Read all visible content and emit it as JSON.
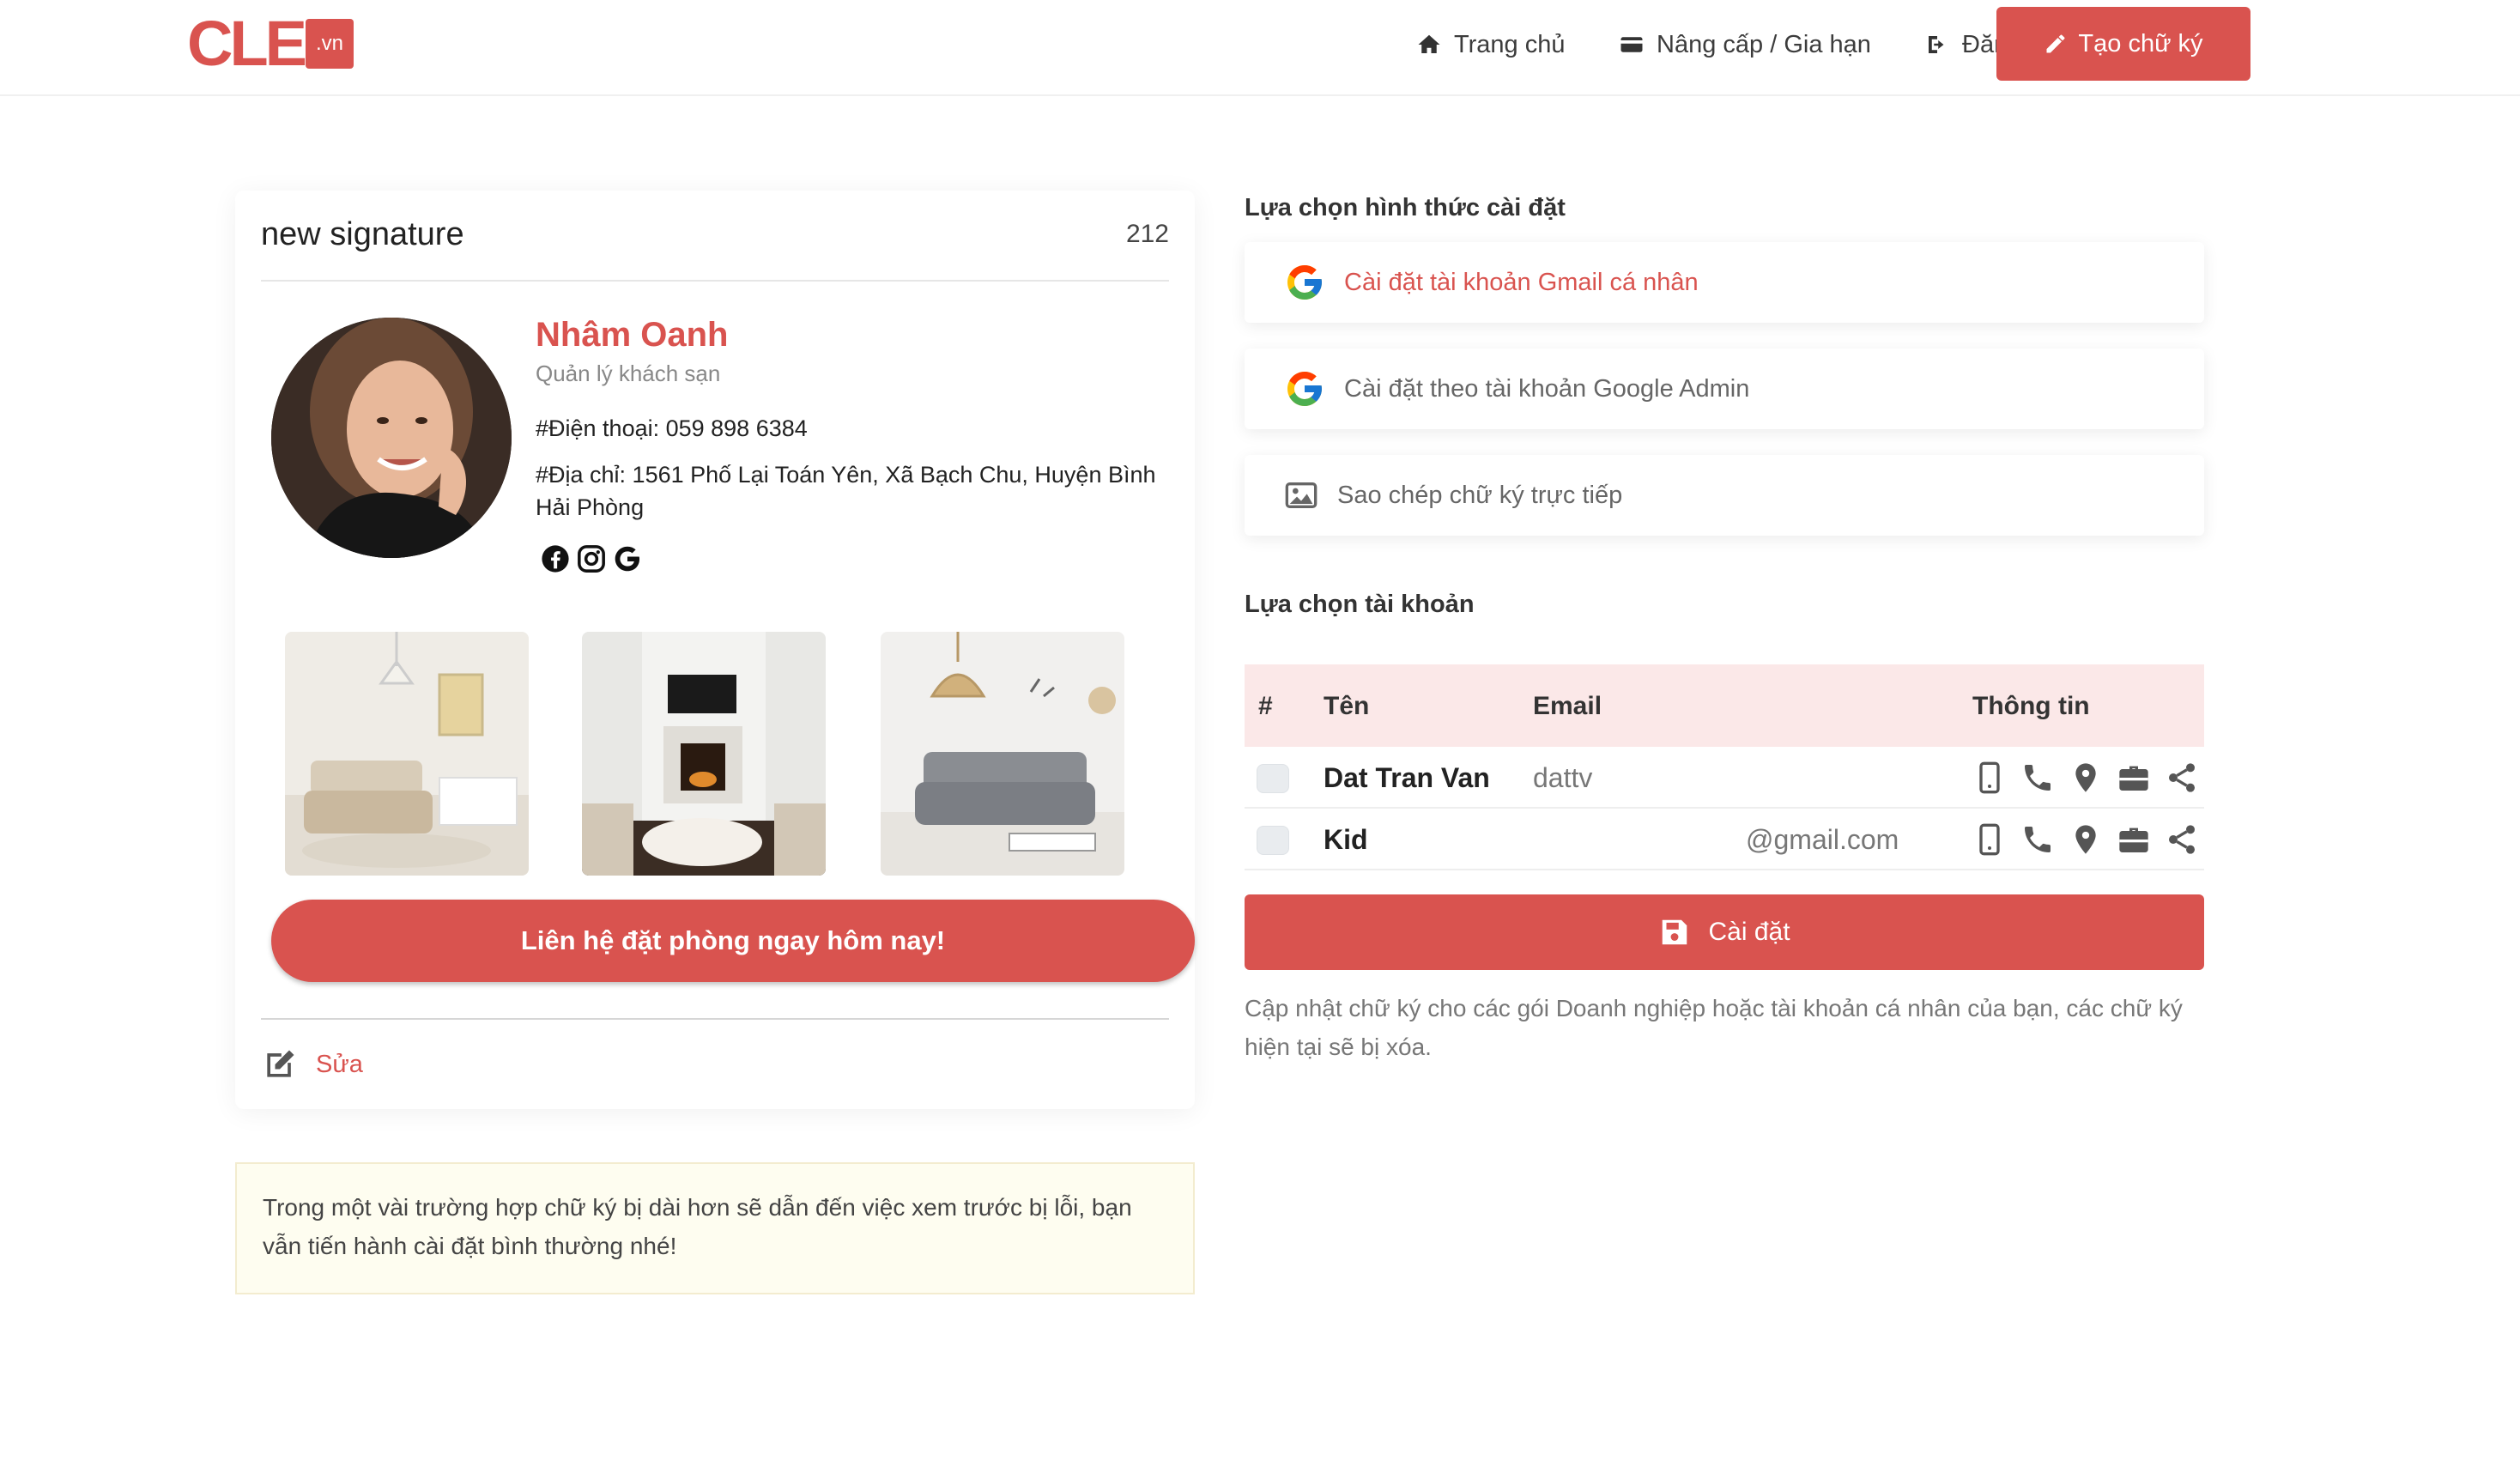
{
  "header": {
    "logo_text": "CLE",
    "logo_badge": ".vn",
    "nav": {
      "home": "Trang chủ",
      "upgrade": "Nâng cấp / Gia hạn",
      "logout": "Đăng xuất"
    },
    "create_button": "Tạo chữ ký"
  },
  "signature_card": {
    "title": "new signature",
    "count": "212",
    "name": "Nhâm Oanh",
    "role": "Quản lý khách sạn",
    "phone": "#Điện thoại: 059 898 6384",
    "address": "#Địa chỉ: 1561 Phố Lại Toán Yên, Xã Bạch Chu, Huyện Bình Hải Phòng",
    "cta": "Liên hệ đặt phòng ngay hôm nay!",
    "edit_label": "Sửa"
  },
  "notice": "Trong một vài trường hợp chữ ký bị dài hơn sẽ dẫn đến việc xem trước bị lỗi, bạn vẫn tiến hành cài đặt bình thường nhé!",
  "install_method": {
    "title": "Lựa chọn hình thức cài đặt",
    "options": [
      "Cài đặt tài khoản Gmail cá nhân",
      "Cài đặt theo tài khoản Google Admin",
      "Sao chép chữ ký trực tiếp"
    ]
  },
  "accounts": {
    "title": "Lựa chọn tài khoản",
    "columns": [
      "#",
      "Tên",
      "Email",
      "Thông tin"
    ],
    "rows": [
      {
        "name": "Dat Tran Van",
        "email": "dattv"
      },
      {
        "name": "Kid",
        "email": "@gmail.com"
      }
    ]
  },
  "install_button": "Cài đặt",
  "description": "Cập nhật chữ ký cho các gói Doanh nghiệp hoặc tài khoản cá nhân của bạn, các chữ ký hiện tại sẽ bị xóa.",
  "colors": {
    "accent": "#d9534f",
    "table_header": "#fbe8e8",
    "notice_bg": "#fefdf0"
  }
}
